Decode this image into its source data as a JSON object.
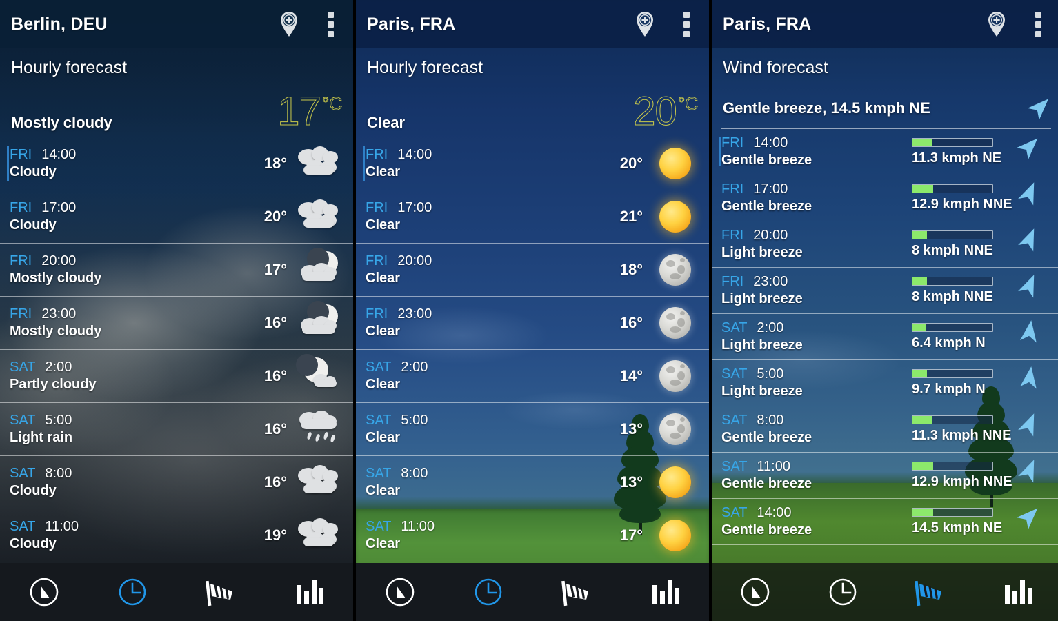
{
  "panels": [
    {
      "id": "berlin-hourly",
      "city": "Berlin, DEU",
      "section_title": "Hourly forecast",
      "condition": "Mostly cloudy",
      "temp_value": "17",
      "temp_unit": "°C",
      "active_tab": "clock",
      "rows": [
        {
          "day": "FRI",
          "time": "14:00",
          "cond": "Cloudy",
          "temp": "18°",
          "icon": "cloudy"
        },
        {
          "day": "FRI",
          "time": "17:00",
          "cond": "Cloudy",
          "temp": "20°",
          "icon": "cloudy"
        },
        {
          "day": "FRI",
          "time": "20:00",
          "cond": "Mostly cloudy",
          "temp": "17°",
          "icon": "night-mostly-cloudy"
        },
        {
          "day": "FRI",
          "time": "23:00",
          "cond": "Mostly cloudy",
          "temp": "16°",
          "icon": "night-mostly-cloudy"
        },
        {
          "day": "SAT",
          "time": "2:00",
          "cond": "Partly cloudy",
          "temp": "16°",
          "icon": "night-partly-cloudy"
        },
        {
          "day": "SAT",
          "time": "5:00",
          "cond": "Light rain",
          "temp": "16°",
          "icon": "light-rain"
        },
        {
          "day": "SAT",
          "time": "8:00",
          "cond": "Cloudy",
          "temp": "16°",
          "icon": "cloudy"
        },
        {
          "day": "SAT",
          "time": "11:00",
          "cond": "Cloudy",
          "temp": "19°",
          "icon": "cloudy"
        }
      ]
    },
    {
      "id": "paris-hourly",
      "city": "Paris, FRA",
      "section_title": "Hourly forecast",
      "condition": "Clear",
      "temp_value": "20",
      "temp_unit": "°C",
      "active_tab": "clock",
      "rows": [
        {
          "day": "FRI",
          "time": "14:00",
          "cond": "Clear",
          "temp": "20°",
          "icon": "sun"
        },
        {
          "day": "FRI",
          "time": "17:00",
          "cond": "Clear",
          "temp": "21°",
          "icon": "sun"
        },
        {
          "day": "FRI",
          "time": "20:00",
          "cond": "Clear",
          "temp": "18°",
          "icon": "moon"
        },
        {
          "day": "FRI",
          "time": "23:00",
          "cond": "Clear",
          "temp": "16°",
          "icon": "moon"
        },
        {
          "day": "SAT",
          "time": "2:00",
          "cond": "Clear",
          "temp": "14°",
          "icon": "moon"
        },
        {
          "day": "SAT",
          "time": "5:00",
          "cond": "Clear",
          "temp": "13°",
          "icon": "moon"
        },
        {
          "day": "SAT",
          "time": "8:00",
          "cond": "Clear",
          "temp": "13°",
          "icon": "sun"
        },
        {
          "day": "SAT",
          "time": "11:00",
          "cond": "Clear",
          "temp": "17°",
          "icon": "sun"
        }
      ]
    },
    {
      "id": "paris-wind",
      "city": "Paris, FRA",
      "section_title": "Wind forecast",
      "condition": "Gentle breeze, 14.5 kmph NE",
      "active_tab": "wind",
      "rows": [
        {
          "day": "FRI",
          "time": "14:00",
          "cond": "Gentle breeze",
          "speed": "11.3 kmph NE",
          "bar_pct": 24,
          "dir_deg": 45
        },
        {
          "day": "FRI",
          "time": "17:00",
          "cond": "Gentle breeze",
          "speed": "12.9 kmph NNE",
          "bar_pct": 26,
          "dir_deg": 23
        },
        {
          "day": "FRI",
          "time": "20:00",
          "cond": "Light breeze",
          "speed": "8 kmph NNE",
          "bar_pct": 18,
          "dir_deg": 23
        },
        {
          "day": "FRI",
          "time": "23:00",
          "cond": "Light breeze",
          "speed": "8 kmph NNE",
          "bar_pct": 18,
          "dir_deg": 23
        },
        {
          "day": "SAT",
          "time": "2:00",
          "cond": "Light breeze",
          "speed": "6.4 kmph N",
          "bar_pct": 16,
          "dir_deg": 8
        },
        {
          "day": "SAT",
          "time": "5:00",
          "cond": "Light breeze",
          "speed": "9.7 kmph N",
          "bar_pct": 18,
          "dir_deg": 8
        },
        {
          "day": "SAT",
          "time": "8:00",
          "cond": "Gentle breeze",
          "speed": "11.3 kmph NNE",
          "bar_pct": 24,
          "dir_deg": 23
        },
        {
          "day": "SAT",
          "time": "11:00",
          "cond": "Gentle breeze",
          "speed": "12.9 kmph NNE",
          "bar_pct": 26,
          "dir_deg": 23
        },
        {
          "day": "SAT",
          "time": "14:00",
          "cond": "Gentle breeze",
          "speed": "14.5 kmph NE",
          "bar_pct": 26,
          "dir_deg": 45
        }
      ]
    }
  ],
  "icons": {
    "add_location": "map-pin-plus-icon",
    "overflow": "overflow-menu-icon",
    "nav": [
      "compass-icon",
      "clock-icon",
      "windsock-icon",
      "bar-chart-icon"
    ]
  },
  "colors": {
    "accent_blue": "#37a6e8",
    "temp_yellow": "#c9c94a",
    "wind_bar_green": "#8ce96b",
    "arrow_blue": "#7dc8f0"
  }
}
